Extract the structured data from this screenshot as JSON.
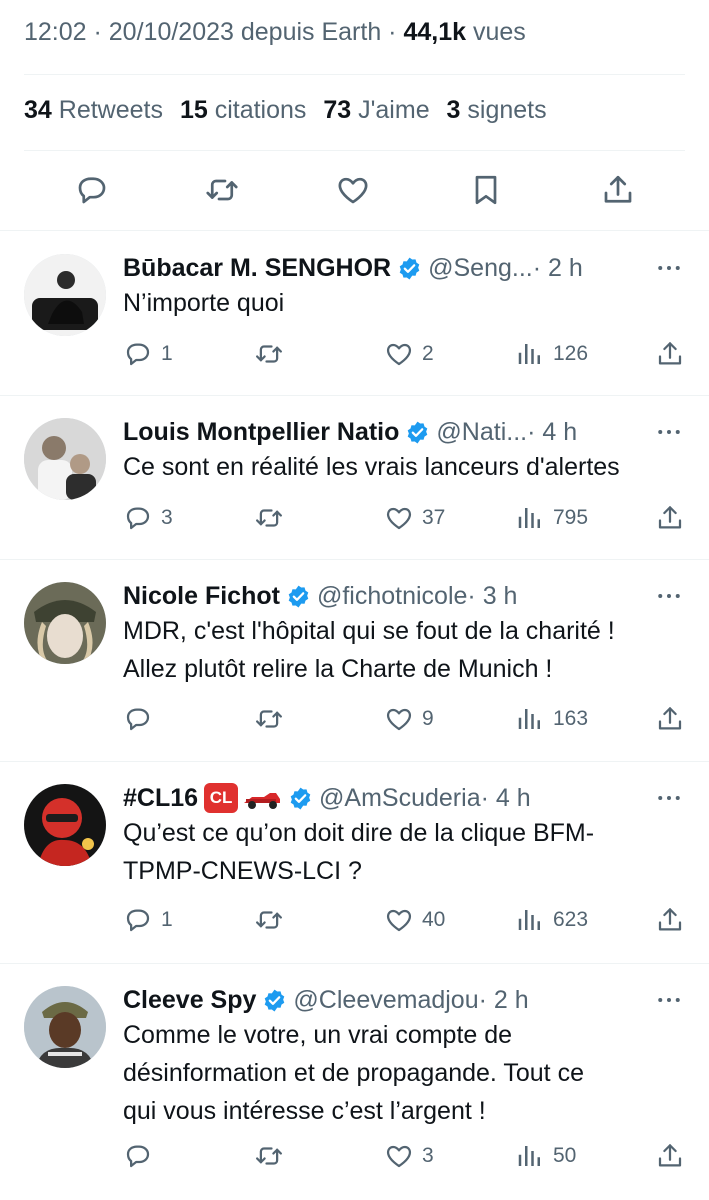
{
  "tweet": {
    "time": "12:02",
    "sep1": " · ",
    "date": "20/10/2023",
    "source": " depuis Earth",
    "sep2": " · ",
    "views_count": "44,1k",
    "views_label": " vues",
    "stats": [
      {
        "count": "34",
        "label": " Retweets"
      },
      {
        "count": "15",
        "label": " citations"
      },
      {
        "count": "73",
        "label": " J'aime"
      },
      {
        "count": "3",
        "label": " signets"
      }
    ]
  },
  "icons": {
    "reply": "reply-icon",
    "retweet": "retweet-icon",
    "like": "heart-icon",
    "bookmark": "bookmark-icon",
    "share": "share-icon",
    "views": "views-icon",
    "more": "more-icon",
    "verified": "verified-badge-icon"
  },
  "colors": {
    "text": "#0f1419",
    "secondary": "#536471",
    "verified": "#1d9bf0",
    "divider": "#eff3f4"
  },
  "replies": [
    {
      "name": "Būbacar M. SENGHOR",
      "handle": "@Seng...",
      "time": "· 2 h",
      "text": "N’importe quoi",
      "reply_count": "1",
      "retweet_count": "",
      "like_count": "2",
      "view_count": "126"
    },
    {
      "name": "Louis Montpellier Natio",
      "handle": "@Nati...",
      "time": "· 4 h",
      "text": "Ce sont en réalité les vrais lanceurs d'alertes",
      "reply_count": "3",
      "retweet_count": "",
      "like_count": "37",
      "view_count": "795"
    },
    {
      "name": "Nicole Fichot",
      "handle": "@fichotnicole",
      "time": "· 3 h",
      "text_line1": "MDR, c'est l'hôpital qui se fout de la charité !",
      "text_line2": "Allez plutôt relire la Charte de Munich !",
      "reply_count": "",
      "retweet_count": "",
      "like_count": "9",
      "view_count": "163"
    },
    {
      "name": "#CL16",
      "badge": "CL",
      "handle": "@AmScuderia",
      "time": "· 4 h",
      "text_line1": "Qu’est ce qu’on doit dire de la clique BFM-",
      "text_line2": "TPMP-CNEWS-LCI ?",
      "reply_count": "1",
      "retweet_count": "",
      "like_count": "40",
      "view_count": "623"
    },
    {
      "name": "Cleeve Spy",
      "handle": "@Cleevemadjou",
      "time": "· 2 h",
      "text_line1": "Comme le votre, un vrai compte de",
      "text_line2": "désinformation et de propagande. Tout ce",
      "text_line3": "qui vous intéresse c’est l’argent !",
      "reply_count": "",
      "retweet_count": "",
      "like_count": "3",
      "view_count": "50"
    }
  ]
}
